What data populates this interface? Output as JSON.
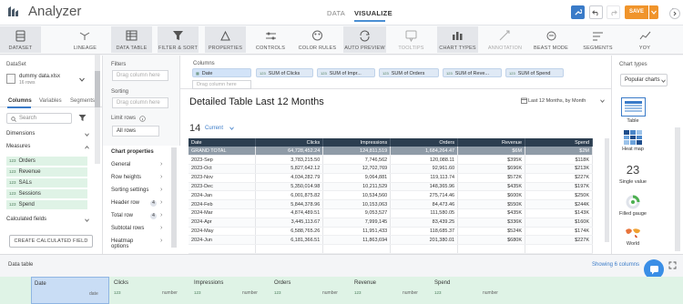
{
  "app": {
    "title": "Analyzer"
  },
  "nav": {
    "data": "DATA",
    "visualize": "VISUALIZE"
  },
  "header_actions": {
    "save": "SAVE"
  },
  "toolbar": [
    {
      "label": "DATASET",
      "icon": "dataset-icon",
      "active": true
    },
    {
      "label": "LINEAGE",
      "icon": "lineage-icon",
      "active": false
    },
    {
      "label": "DATA TABLE",
      "icon": "data-table-icon",
      "active": true
    },
    {
      "label": "FILTER & SORT",
      "icon": "filter-icon",
      "active": true
    },
    {
      "label": "PROPERTIES",
      "icon": "properties-icon",
      "active": true
    },
    {
      "label": "CONTROLS",
      "icon": "controls-icon",
      "active": false
    },
    {
      "label": "COLOR RULES",
      "icon": "color-rules-icon",
      "active": false
    },
    {
      "label": "AUTO PREVIEW",
      "icon": "auto-preview-icon",
      "active": true
    },
    {
      "label": "TOOLTIPS",
      "icon": "tooltips-icon",
      "active": false,
      "dim": true
    },
    {
      "label": "CHART TYPES",
      "icon": "chart-types-icon",
      "active": true
    },
    {
      "label": "ANNOTATION",
      "icon": "annotation-icon",
      "active": false,
      "dim": true
    },
    {
      "label": "BEAST MODE",
      "icon": "beast-mode-icon",
      "active": false
    },
    {
      "label": "SEGMENTS",
      "icon": "segments-icon",
      "active": false
    },
    {
      "label": "YOY",
      "icon": "yoy-icon",
      "active": false
    }
  ],
  "dataset": {
    "label": "DataSet",
    "file": "dummy data.xlsx",
    "rows": "16 rows",
    "tabs": [
      "Columns",
      "Variables",
      "Segments"
    ],
    "search_placeholder": "Search",
    "dimensions_label": "Dimensions",
    "measures_label": "Measures",
    "measures": [
      "Orders",
      "Revenue",
      "SALs",
      "Sessions",
      "Spend"
    ],
    "calculated_label": "Calculated fields",
    "create_button": "CREATE CALCULATED FIELD",
    "badge": "123"
  },
  "properties": {
    "filters_label": "Filters",
    "filters_placeholder": "Drag column here",
    "sorting_label": "Sorting",
    "sorting_placeholder": "Drag column here",
    "limit_label": "Limit rows",
    "limit_value": "All rows",
    "chart_props_title": "Chart properties",
    "items": [
      {
        "label": "General",
        "num": ""
      },
      {
        "label": "Row heights",
        "num": ""
      },
      {
        "label": "Sorting settings",
        "num": ""
      },
      {
        "label": "Header row",
        "num": "4"
      },
      {
        "label": "Total row",
        "num": "4"
      },
      {
        "label": "Subtotal rows",
        "num": ""
      },
      {
        "label": "Heatmap",
        "num": ""
      },
      {
        "label": "options",
        "num": ""
      }
    ]
  },
  "columns_bar": {
    "label": "Columns",
    "pills": [
      "Date",
      "SUM of Clicks",
      "SUM of Impr...",
      "SUM of Orders",
      "SUM of Reve...",
      "SUM of Spend"
    ],
    "drop_placeholder": "Drag column here",
    "badge": "123"
  },
  "chart": {
    "title": "Detailed Table Last 12 Months",
    "range": "Last 12 Months, by Month",
    "count": "14",
    "count_label": "Current",
    "headers": [
      "Date",
      "Clicks",
      "Impressions",
      "Orders",
      "Revenue",
      "Spend"
    ],
    "grand_total": [
      "GRAND TOTAL",
      "64,728,452.24",
      "124,811,519",
      "1,684,264.47",
      "$6M",
      "$2M"
    ],
    "rows": [
      [
        "2023-Sep",
        "3,783,215.50",
        "7,746,562",
        "120,088.11",
        "$395K",
        "$118K"
      ],
      [
        "2023-Oct",
        "5,827,642.12",
        "12,702,769",
        "92,961.60",
        "$696K",
        "$213K"
      ],
      [
        "2023-Nov",
        "4,034,282.79",
        "9,064,881",
        "119,113.74",
        "$572K",
        "$227K"
      ],
      [
        "2023-Dec",
        "5,350,014.98",
        "10,211,529",
        "148,365.96",
        "$435K",
        "$197K"
      ],
      [
        "2024-Jan",
        "6,001,875.82",
        "10,534,560",
        "275,714.46",
        "$600K",
        "$250K"
      ],
      [
        "2024-Feb",
        "5,844,378.96",
        "10,153,063",
        "84,473.46",
        "$550K",
        "$244K"
      ],
      [
        "2024-Mar",
        "4,874,489.51",
        "9,053,527",
        "111,580.05",
        "$435K",
        "$143K"
      ],
      [
        "2024-Apr",
        "3,445,113.67",
        "7,999,145",
        "83,439.25",
        "$336K",
        "$160K"
      ],
      [
        "2024-May",
        "6,588,765.26",
        "11,951,433",
        "118,685.37",
        "$524K",
        "$174K"
      ],
      [
        "2024-Jun",
        "6,181,366.51",
        "11,863,694",
        "201,380.01",
        "$680K",
        "$227K"
      ],
      [
        "",
        "",
        "",
        "",
        "",
        ""
      ]
    ]
  },
  "chart_types": {
    "label": "Chart types",
    "select": "Popular charts",
    "items": [
      {
        "label": "Table",
        "icon": "table-chart-icon"
      },
      {
        "label": "Heat map",
        "icon": "heat-map-icon"
      },
      {
        "label": "Single value",
        "icon": "single-value-icon",
        "value": "23"
      },
      {
        "label": "Filled gauge",
        "icon": "filled-gauge-icon"
      },
      {
        "label": "World",
        "icon": "world-map-icon"
      }
    ]
  },
  "data_table": {
    "label": "Data table",
    "showing": "Showing 6 columns",
    "columns": [
      {
        "name": "Date",
        "type": "date",
        "badge": ""
      },
      {
        "name": "Clicks",
        "type": "number",
        "badge": "123"
      },
      {
        "name": "Impressions",
        "type": "number",
        "badge": "123"
      },
      {
        "name": "Orders",
        "type": "number",
        "badge": "123"
      },
      {
        "name": "Revenue",
        "type": "number",
        "badge": "123"
      },
      {
        "name": "Spend",
        "type": "number",
        "badge": "123"
      }
    ]
  },
  "colors": {
    "accent": "#3a7bc8",
    "save": "#f0942b",
    "measure_bg": "#dff3e6",
    "table_header": "#2c3e50"
  }
}
